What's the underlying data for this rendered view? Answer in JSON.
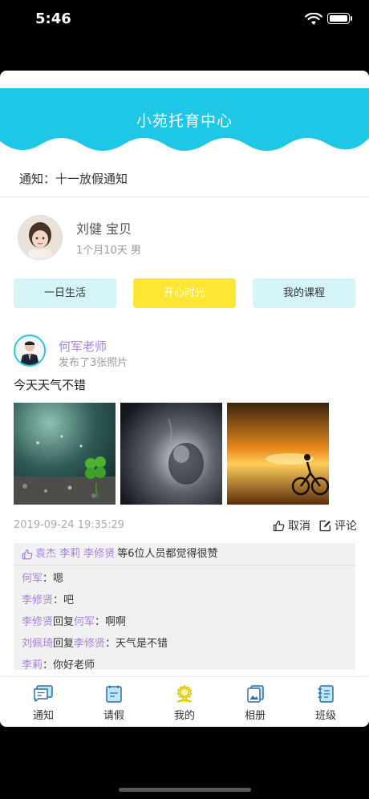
{
  "status_bar": {
    "time": "5:46"
  },
  "header": {
    "title": "小苑托育中心"
  },
  "notice": {
    "text": "通知：十一放假通知"
  },
  "profile": {
    "name": "刘健 宝贝",
    "info": "1个月10天 男"
  },
  "tabs": [
    {
      "label": "一日生活"
    },
    {
      "label": "开心时光"
    },
    {
      "label": "我的课程"
    }
  ],
  "post": {
    "teacher_name": "何军老师",
    "subtitle": "发布了3张照片",
    "text": "今天天气不错",
    "time": "2019-09-24 19:35:29",
    "cancel_label": "取消",
    "comment_label": "评论"
  },
  "likes": {
    "names": "袁杰 李莉 李修贤",
    "suffix": "等6位人员都觉得很赞"
  },
  "comments": [
    {
      "author": "何军",
      "reply_word": "",
      "target": "",
      "text": "：嗯"
    },
    {
      "author": "李修贤",
      "reply_word": "",
      "target": "",
      "text": "：吧"
    },
    {
      "author": "李修贤",
      "reply_word": "回复",
      "target": "何军",
      "text": "：啊啊"
    },
    {
      "author": "刘佩琦",
      "reply_word": "回复",
      "target": "李修贤",
      "text": "：天气是不错"
    },
    {
      "author": "李莉",
      "reply_word": "",
      "target": "",
      "text": "：你好老师"
    }
  ],
  "tabbar": [
    {
      "label": "通知",
      "icon": "notice-icon"
    },
    {
      "label": "请假",
      "icon": "leave-icon"
    },
    {
      "label": "我的",
      "icon": "mine-icon"
    },
    {
      "label": "相册",
      "icon": "album-icon"
    },
    {
      "label": "班级",
      "icon": "class-icon"
    }
  ],
  "colors": {
    "header": "#1fc7e6",
    "accent_purple": "#a782e0",
    "tab_light": "#d4f4f7",
    "tab_active": "#ffe534"
  }
}
